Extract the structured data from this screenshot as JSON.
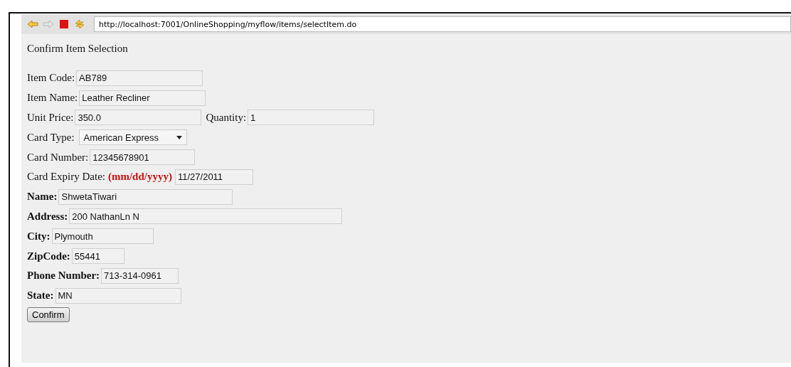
{
  "toolbar": {
    "address": "http://localhost:7001/OnlineShopping/myflow/items/selectItem.do"
  },
  "page": {
    "heading": "Confirm Item Selection",
    "rows": [
      {
        "label": "Item Code:",
        "bold": false,
        "fields": [
          {
            "kind": "text",
            "value": "AB789"
          }
        ]
      },
      {
        "label": "Item Name:",
        "bold": false,
        "fields": [
          {
            "kind": "text",
            "value": "Leather Recliner"
          }
        ]
      },
      {
        "label": "Unit Price:",
        "bold": false,
        "fields": [
          {
            "kind": "text",
            "value": "350.0"
          },
          {
            "kind": "text",
            "label": "Quantity:",
            "value": "1"
          }
        ]
      },
      {
        "label": "Card Type:",
        "bold": false,
        "fields": [
          {
            "kind": "select",
            "value": "American Express"
          }
        ]
      },
      {
        "label": "Card Number:",
        "bold": false,
        "fields": [
          {
            "kind": "text",
            "value": "12345678901"
          }
        ]
      },
      {
        "label": "Card Expiry Date:",
        "bold": false,
        "hint": "(mm/dd/yyyy)",
        "fields": [
          {
            "kind": "text",
            "value": "11/27/2011"
          }
        ]
      },
      {
        "label": "Name:",
        "bold": true,
        "fields": [
          {
            "kind": "text",
            "value": "ShwetaTiwari"
          }
        ]
      },
      {
        "label": "Address:",
        "bold": true,
        "fields": [
          {
            "kind": "text",
            "value": "200 NathanLn N"
          }
        ]
      },
      {
        "label": "City:",
        "bold": true,
        "fields": [
          {
            "kind": "text",
            "value": "Plymouth"
          }
        ]
      },
      {
        "label": "ZipCode:",
        "bold": true,
        "fields": [
          {
            "kind": "text",
            "value": "55441"
          }
        ]
      },
      {
        "label": "Phone Number:",
        "bold": true,
        "fields": [
          {
            "kind": "text",
            "value": "713-314-0961"
          }
        ]
      },
      {
        "label": "State:",
        "bold": true,
        "fields": [
          {
            "kind": "text",
            "value": "MN"
          }
        ]
      }
    ],
    "button": "Confirm"
  }
}
